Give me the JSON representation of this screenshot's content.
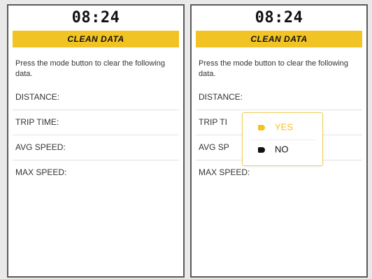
{
  "screens": [
    {
      "time": "08:24",
      "title": "CLEAN DATA",
      "instruction": "Press the mode button to clear the following data.",
      "items": [
        "DISTANCE:",
        "TRIP TIME:",
        "AVG SPEED:",
        "MAX SPEED:"
      ]
    },
    {
      "time": "08:24",
      "title": "CLEAN DATA",
      "instruction": "Press the mode button to clear the following data.",
      "items": [
        "DISTANCE:",
        "TRIP TI",
        "AVG SP",
        "MAX SPEED:"
      ],
      "dialog": {
        "options": [
          {
            "label": "YES",
            "icon": "tag-icon",
            "color": "#f2c324",
            "selected": true
          },
          {
            "label": "NO",
            "icon": "tag-icon",
            "color": "#111111",
            "selected": false
          }
        ]
      }
    }
  ],
  "colors": {
    "accent": "#f2c324",
    "frame": "#5a5a5a",
    "text": "#333333"
  }
}
